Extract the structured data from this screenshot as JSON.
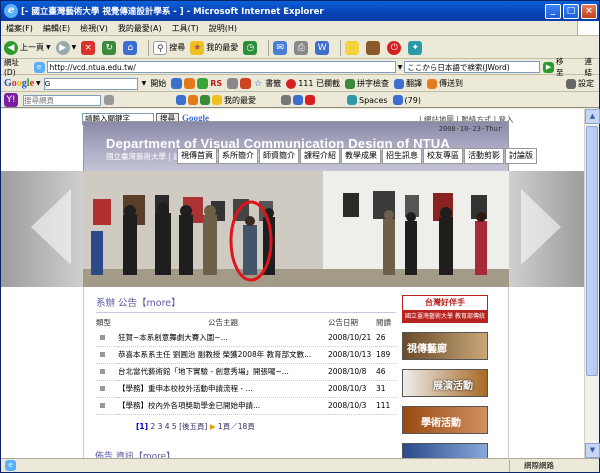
{
  "window": {
    "title": "[- 國立臺灣藝術大學 視覺傳達設計學系 - ] - Microsoft Internet Explorer",
    "buttons": [
      "_",
      "□",
      "×"
    ]
  },
  "menubar": [
    "檔案(F)",
    "編輯(E)",
    "檢視(V)",
    "我的最愛(A)",
    "工具(T)",
    "說明(H)"
  ],
  "toolbar": {
    "back": "上一頁",
    "search": "搜尋",
    "favorites": "我的最愛"
  },
  "address": {
    "label": "網址(D)",
    "url": "http://vcd.ntua.edu.tw/",
    "translate_placeholder": "ここから日本語で検索(JWord)",
    "go": "移至",
    "links": "連結"
  },
  "google_toolbar": {
    "logo": "Google",
    "g_field": "G",
    "start": "開始",
    "rs": "RS",
    "bookmarks": "書籤",
    "blocked": "111 已攔截",
    "spell": "拼字檢查",
    "translate": "翻譯",
    "sendto": "傳送到",
    "settings": "設定"
  },
  "yahoo_toolbar": {
    "search_placeholder": "搜尋網頁",
    "favorites": "我的最愛",
    "spaces": "Spaces",
    "count": "(79)"
  },
  "page": {
    "search_input": "請輸入關鍵字",
    "search_btn": "搜尋",
    "google_logo": "Google",
    "top_links": "| 網站地圖 | 聯絡方式 | 登入",
    "banner_title_en": "Department of Visual Communication Design of NTUA",
    "banner_title_zh": "國立臺灣藝術大學 | 設計學院 | 視覺傳達設計學系",
    "date": "2008-10-23-Thur",
    "nav": [
      "視傳首頁",
      "系所簡介",
      "師資簡介",
      "課程介紹",
      "教學成果",
      "招生訊息",
      "校友專區",
      "活動剪影",
      "討論版"
    ],
    "news": {
      "heading": "系辦 公告【more】",
      "col_type": "類型",
      "col_title": "公告主題",
      "col_date": "公告日期",
      "col_views": "閱讀",
      "rows": [
        {
          "title": "狂賀~本系創意舞劇大賽入圍~...",
          "date": "2008/10/21",
          "views": "26"
        },
        {
          "title": "恭喜本系系主任 劉圓治 副教授 榮獲2008年 教育部文數...",
          "date": "2008/10/13",
          "views": "189"
        },
        {
          "title": "台北當代藝術館「地下實驗 - 創意秀場」開張囉~...",
          "date": "2008/10/8",
          "views": "46"
        },
        {
          "title": "【學務】重申本校校外活動申請流程 - ...",
          "date": "2008/10/3",
          "views": "31"
        },
        {
          "title": "【學務】校內外各項獎助學金已開始申請...",
          "date": "2008/10/3",
          "views": "111"
        }
      ],
      "pager": {
        "current": "[1]",
        "pages": "2 3 4 5 [後五頁]",
        "info": "1頁／18頁"
      }
    },
    "news2_heading": "佈告 資訊【more】",
    "side_cards": [
      {
        "label": "台灣好伴手",
        "sub": "國立臺灣藝術大學 教育部傳統",
        "color": "#b8231f"
      },
      {
        "label": "視傳藝廊",
        "sub": "",
        "color": "#6a4a2a"
      },
      {
        "label": "展演活動",
        "sub": "",
        "color": "#a66a24"
      },
      {
        "label": "學術活動",
        "sub": "",
        "color": "#9a4a12"
      },
      {
        "label": "",
        "sub": "",
        "color": "#2a4a8a"
      }
    ]
  },
  "status": {
    "zone": "網際網路"
  }
}
